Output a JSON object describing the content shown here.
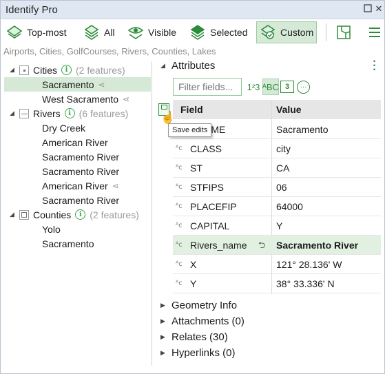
{
  "window": {
    "title": "Identify Pro"
  },
  "toolbar": {
    "buttons": [
      {
        "label": "Top-most",
        "icon": "layers-top-icon"
      },
      {
        "label": "All",
        "icon": "layers-all-icon"
      },
      {
        "label": "Visible",
        "icon": "layers-visible-icon"
      },
      {
        "label": "Selected",
        "icon": "layers-selected-icon"
      },
      {
        "label": "Custom",
        "icon": "layers-custom-icon"
      }
    ],
    "active": "Custom"
  },
  "layers_line": "Airports, Cities, GolfCourses, Rivers, Counties, Lakes",
  "tree": {
    "groups": [
      {
        "name": "Cities",
        "count": "(2 features)",
        "items": [
          "Sacramento",
          "West Sacramento"
        ]
      },
      {
        "name": "Rivers",
        "count": "(6 features)",
        "items": [
          "Dry Creek",
          "American River",
          "Sacramento River",
          "Sacramento River",
          "American River",
          "Sacramento River"
        ]
      },
      {
        "name": "Counties",
        "count": "(2 features)",
        "items": [
          "Yolo",
          "Sacramento"
        ]
      }
    ],
    "selected": "Sacramento"
  },
  "attributes": {
    "header": "Attributes",
    "filter_placeholder": "Filter fields...",
    "col_field": "Field",
    "col_value": "Value",
    "rows": [
      {
        "field": "NAME",
        "value": "Sacramento",
        "partial_field": "AME"
      },
      {
        "field": "CLASS",
        "value": "city"
      },
      {
        "field": "ST",
        "value": "CA"
      },
      {
        "field": "STFIPS",
        "value": "06"
      },
      {
        "field": "PLACEFIP",
        "value": "64000"
      },
      {
        "field": "CAPITAL",
        "value": "Y"
      },
      {
        "field": "Rivers_name",
        "value": "Sacramento River"
      },
      {
        "field": "X",
        "value": "121° 28.136' W"
      },
      {
        "field": "Y",
        "value": "38° 33.336' N"
      }
    ],
    "tooltip": "Save edits",
    "numeric_icon": "1²3",
    "alpha_icon": "ᴬBC",
    "date_icon": "3"
  },
  "sections": [
    {
      "label": "Geometry Info"
    },
    {
      "label": "Attachments (0)"
    },
    {
      "label": "Relates (30)"
    },
    {
      "label": "Hyperlinks (0)"
    }
  ],
  "colors": {
    "accent": "#2e8b3d",
    "selection": "#d6e9d7"
  }
}
